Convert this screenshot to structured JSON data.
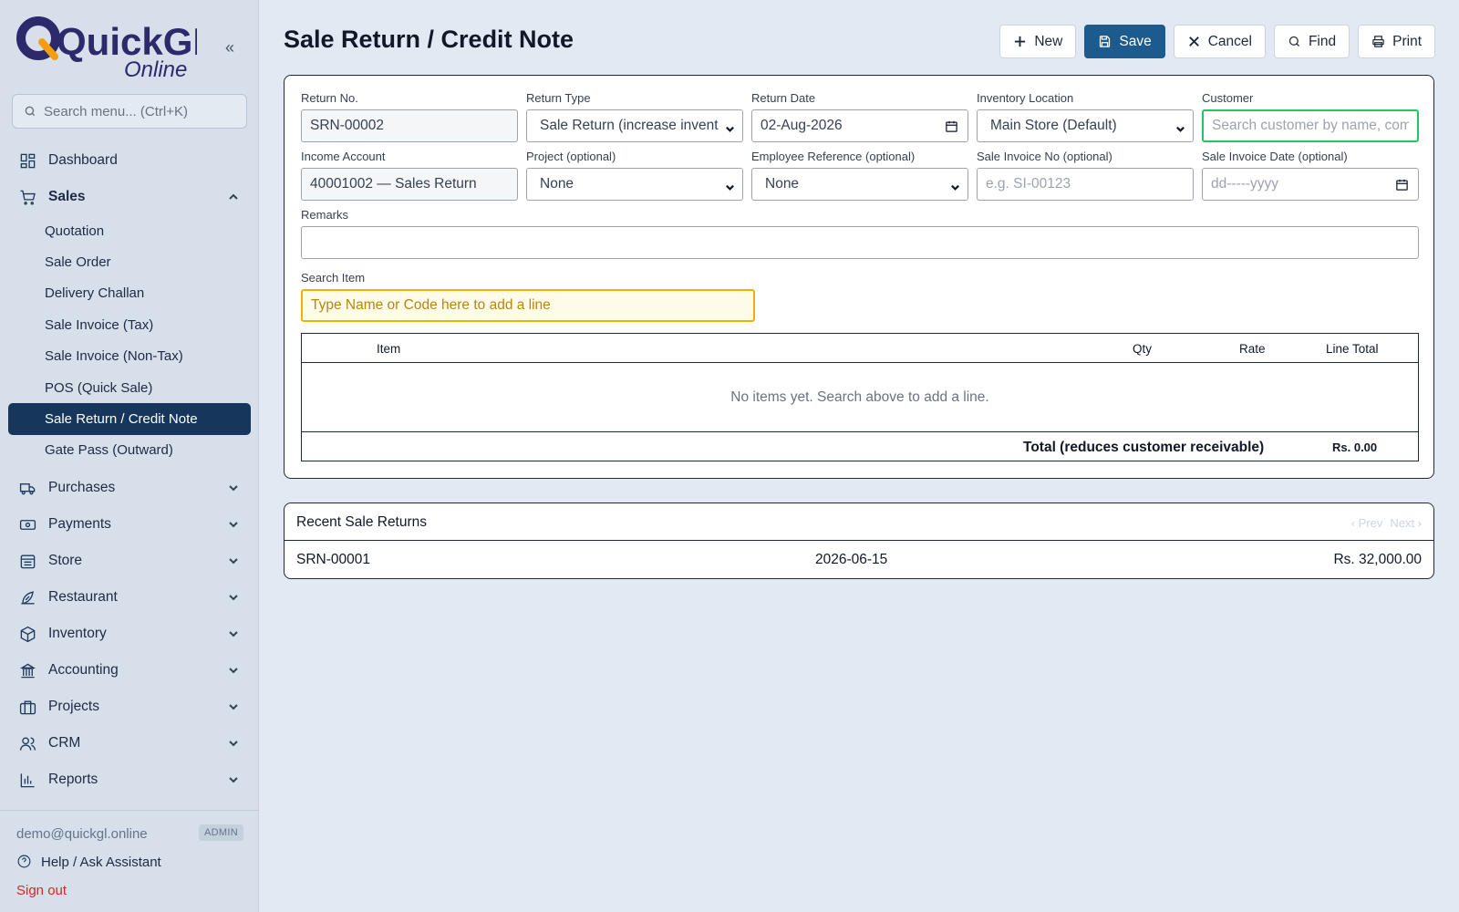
{
  "brand": {
    "name": "QuickGL",
    "tagline": "Online",
    "colors": {
      "primary": "#2b2a6b",
      "accent": "#f59e0b",
      "navy": "#16365c",
      "save": "#1d5b8f"
    }
  },
  "sidebar": {
    "search_placeholder": "Search menu... (Ctrl+K)",
    "items": [
      {
        "label": "Dashboard",
        "icon": "dashboard-icon",
        "expandable": false
      },
      {
        "label": "Sales",
        "icon": "cart-icon",
        "expandable": true,
        "expanded": true,
        "children": [
          {
            "label": "Quotation",
            "active": false
          },
          {
            "label": "Sale Order",
            "active": false
          },
          {
            "label": "Delivery Challan",
            "active": false
          },
          {
            "label": "Sale Invoice (Tax)",
            "active": false
          },
          {
            "label": "Sale Invoice (Non-Tax)",
            "active": false
          },
          {
            "label": "POS (Quick Sale)",
            "active": false
          },
          {
            "label": "Sale Return / Credit Note",
            "active": true
          },
          {
            "label": "Gate Pass (Outward)",
            "active": false
          }
        ]
      },
      {
        "label": "Purchases",
        "icon": "truck-icon",
        "expandable": true
      },
      {
        "label": "Payments",
        "icon": "banknote-icon",
        "expandable": true
      },
      {
        "label": "Store",
        "icon": "store-icon",
        "expandable": true
      },
      {
        "label": "Restaurant",
        "icon": "chef-icon",
        "expandable": true
      },
      {
        "label": "Inventory",
        "icon": "package-icon",
        "expandable": true
      },
      {
        "label": "Accounting",
        "icon": "bank-icon",
        "expandable": true
      },
      {
        "label": "Projects",
        "icon": "briefcase-icon",
        "expandable": true
      },
      {
        "label": "CRM",
        "icon": "users-icon",
        "expandable": true
      },
      {
        "label": "Reports",
        "icon": "bar-chart-icon",
        "expandable": true
      }
    ],
    "footer": {
      "email": "demo@quickgl.online",
      "role_badge": "ADMIN",
      "help": "Help / Ask Assistant",
      "signout": "Sign out"
    }
  },
  "page": {
    "title": "Sale Return / Credit Note"
  },
  "toolbar": {
    "new_label": "New",
    "save_label": "Save",
    "cancel_label": "Cancel",
    "find_label": "Find",
    "print_label": "Print"
  },
  "form": {
    "return_no": {
      "label": "Return No.",
      "value": "SRN-00002"
    },
    "return_type": {
      "label": "Return Type",
      "value": "Sale Return (increase invent"
    },
    "return_date": {
      "label": "Return Date",
      "value": "02-Aug-2026"
    },
    "inventory_location": {
      "label": "Inventory Location",
      "value": "Main Store (Default)"
    },
    "customer": {
      "label": "Customer",
      "placeholder": "Search customer by name, company"
    },
    "income_account": {
      "label": "Income Account",
      "value": "40001002 — Sales Return"
    },
    "project": {
      "label": "Project (optional)",
      "value": "None"
    },
    "employee_reference": {
      "label": "Employee Reference (optional)",
      "value": "None"
    },
    "sale_invoice_no": {
      "label": "Sale Invoice No (optional)",
      "placeholder": "e.g. SI-00123"
    },
    "sale_invoice_date": {
      "label": "Sale Invoice Date (optional)",
      "placeholder": "dd-----yyyy"
    },
    "remarks": {
      "label": "Remarks",
      "value": ""
    },
    "search_item": {
      "label": "Search Item",
      "placeholder": "Type Name or Code here to add a line"
    }
  },
  "items_table": {
    "columns": [
      "Item",
      "Qty",
      "Rate",
      "Line Total"
    ],
    "empty_message": "No items yet. Search above to add a line.",
    "total_label": "Total (reduces customer receivable)",
    "total_value": "Rs. 0.00"
  },
  "recent": {
    "title": "Recent Sale Returns",
    "prev_label": "‹ Prev",
    "next_label": "Next ›",
    "rows": [
      {
        "number": "SRN-00001",
        "date": "2026-06-15",
        "amount": "Rs. 32,000.00"
      }
    ]
  }
}
